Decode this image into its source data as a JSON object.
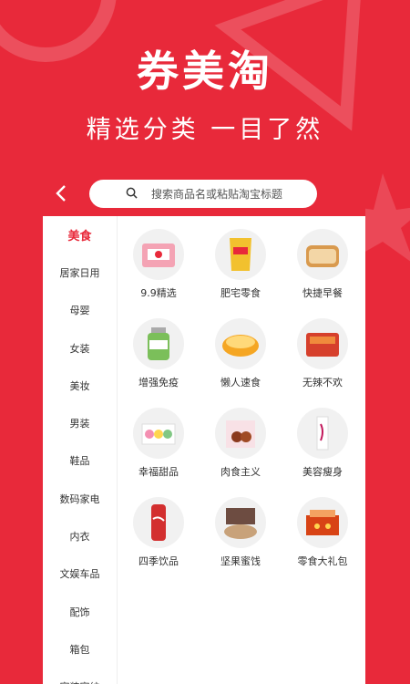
{
  "app": {
    "title": "券美淘",
    "tagline": "精选分类 一目了然"
  },
  "search": {
    "placeholder": "搜索商品名或粘贴淘宝标题"
  },
  "sidebar": {
    "items": [
      {
        "label": "美食",
        "active": true
      },
      {
        "label": "居家日用"
      },
      {
        "label": "母婴"
      },
      {
        "label": "女装"
      },
      {
        "label": "美妆"
      },
      {
        "label": "男装"
      },
      {
        "label": "鞋品"
      },
      {
        "label": "数码家电"
      },
      {
        "label": "内衣"
      },
      {
        "label": "文娱车品"
      },
      {
        "label": "配饰"
      },
      {
        "label": "箱包"
      },
      {
        "label": "家装家纺"
      }
    ]
  },
  "categories": [
    {
      "label": "9.9精选",
      "icon": "snack-box-icon"
    },
    {
      "label": "肥宅零食",
      "icon": "chips-bag-icon"
    },
    {
      "label": "快捷早餐",
      "icon": "bread-icon"
    },
    {
      "label": "增强免疫",
      "icon": "supplement-bottle-icon"
    },
    {
      "label": "懒人速食",
      "icon": "instant-noodle-icon"
    },
    {
      "label": "无辣不欢",
      "icon": "spicy-snack-icon"
    },
    {
      "label": "幸福甜品",
      "icon": "macaron-icon"
    },
    {
      "label": "肉食主义",
      "icon": "meat-icon"
    },
    {
      "label": "美容瘦身",
      "icon": "beauty-drink-icon"
    },
    {
      "label": "四季饮品",
      "icon": "cola-can-icon"
    },
    {
      "label": "坚果蜜饯",
      "icon": "nuts-icon"
    },
    {
      "label": "零食大礼包",
      "icon": "gift-box-icon"
    }
  ],
  "colors": {
    "brand": "#e8293a",
    "active_text": "#e8293a"
  }
}
